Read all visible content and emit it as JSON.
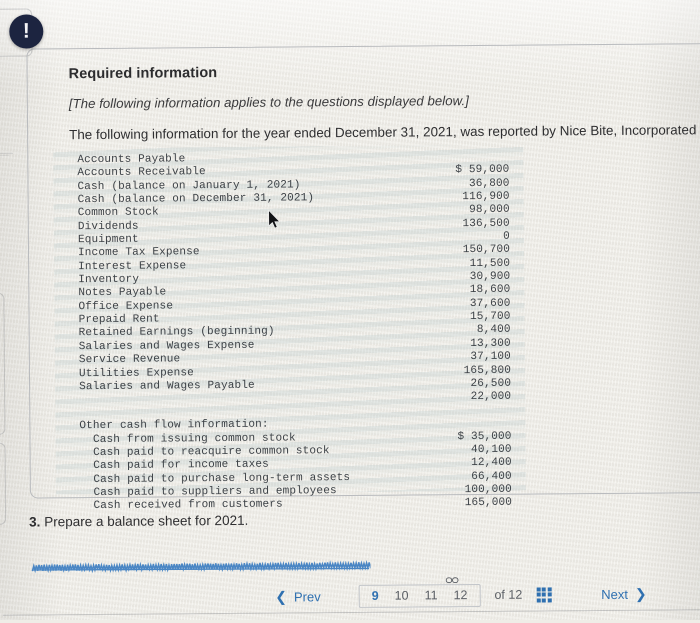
{
  "card": {
    "alert_icon": "exclamation-icon",
    "title": "Required information",
    "note": "[The following information applies to the questions displayed below.]",
    "intro": "The following information for the year ended December 31, 2021, was reported by Nice Bite, Incorporated"
  },
  "ledger": {
    "labels": [
      "Accounts Payable",
      "Accounts Receivable",
      "Cash (balance on January 1, 2021)",
      "Cash (balance on December 31, 2021)",
      "Common Stock",
      "Dividends",
      "Equipment",
      "Income Tax Expense",
      "Interest Expense",
      "Inventory",
      "Notes Payable",
      "Office Expense",
      "Prepaid Rent",
      "Retained Earnings (beginning)",
      "Salaries and Wages Expense",
      "Service Revenue",
      "Utilities Expense",
      "Salaries and Wages Payable"
    ],
    "values": [
      "$ 59,000",
      "36,800",
      "116,900",
      "98,000",
      "136,500",
      "0",
      "150,700",
      "11,500",
      "30,900",
      "18,600",
      "37,600",
      "15,700",
      "8,400",
      "13,300",
      "37,100",
      "165,800",
      "26,500",
      "22,000"
    ]
  },
  "cash_flow": {
    "heading": "Other cash flow information:",
    "labels": [
      "Cash from issuing common stock",
      "Cash paid to reacquire common stock",
      "Cash paid for income taxes",
      "Cash paid to purchase long-term assets",
      "Cash paid to suppliers and employees",
      "Cash received from customers"
    ],
    "values": [
      "$ 35,000",
      "40,100",
      "12,400",
      "66,400",
      "100,000",
      "165,000"
    ]
  },
  "question": {
    "number": "3.",
    "text": "Prepare a balance sheet for 2021."
  },
  "pager": {
    "prev_label": "Prev",
    "next_label": "Next",
    "prev_icon": "chevron-left-icon",
    "next_icon": "chevron-right-icon",
    "link_icon": "link-icon",
    "grid_icon": "grid-icon",
    "pages": [
      "9",
      "10",
      "11",
      "12"
    ],
    "active_page": "9",
    "of_label": "of 12"
  },
  "colors": {
    "accent_blue": "#2f70b0",
    "badge_navy": "#1c2440",
    "page_background": "#efede7",
    "card_border": "#b9bbbe",
    "mono_text": "#3d4247",
    "scribble_blue": "#4a86c4"
  },
  "cursor": {
    "icon": "mouse-pointer-icon"
  }
}
